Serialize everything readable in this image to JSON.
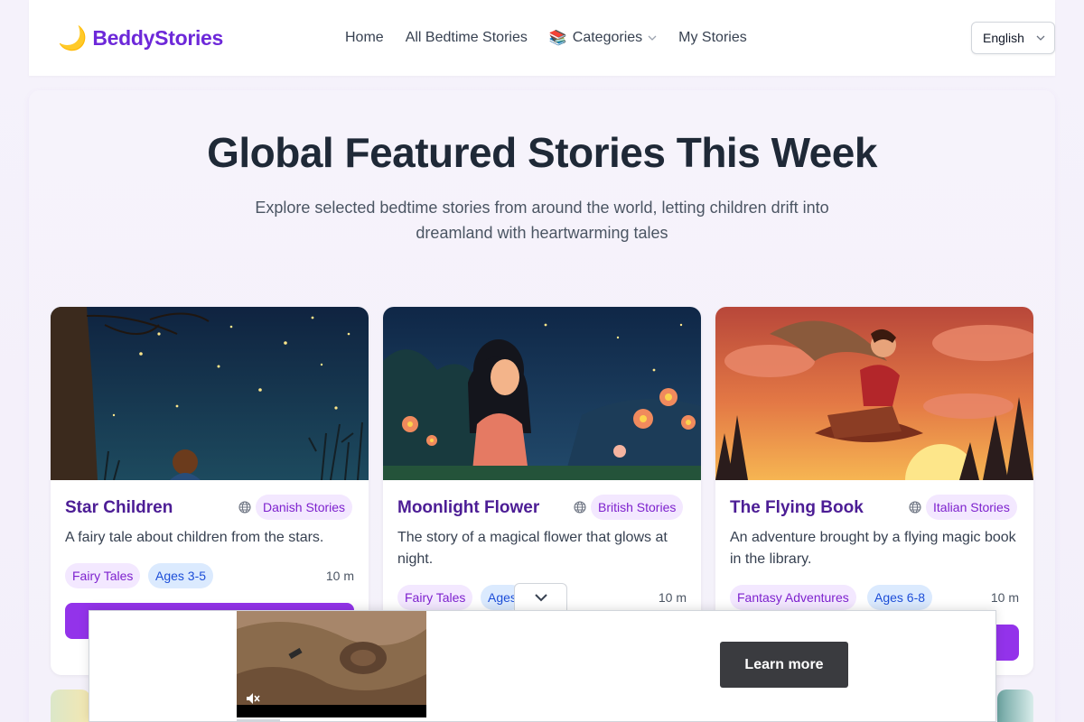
{
  "brand": {
    "logo_icon": "🌙",
    "name": "BeddyStories",
    "color": "#6d28d9"
  },
  "nav": {
    "home": "Home",
    "all_stories": "All Bedtime Stories",
    "categories_icon": "📚",
    "categories": "Categories",
    "my_stories": "My Stories"
  },
  "language": {
    "selected": "English"
  },
  "hero": {
    "title": "Global Featured Stories This Week",
    "subtitle": "Explore selected bedtime stories from around the world, letting children drift into dreamland with heartwarming tales"
  },
  "stories": [
    {
      "title": "Star Children",
      "origin": "Danish Stories",
      "description": "A fairy tale about children from the stars.",
      "tags": [
        "Fairy Tales",
        "Ages 3-5"
      ],
      "read_time": "10 m",
      "image": "starry-night-boy-under-tree"
    },
    {
      "title": "Moonlight Flower",
      "origin": "British Stories",
      "description": "The story of a magical flower that glows at night.",
      "tags": [
        "Fairy Tales",
        "Ages"
      ],
      "read_time": "10 m",
      "image": "girl-with-glowing-flowers"
    },
    {
      "title": "The Flying Book",
      "origin": "Italian Stories",
      "description": "An adventure brought by a flying magic book in the library.",
      "tags": [
        "Fantasy Adventures",
        "Ages 6-8"
      ],
      "read_time": "10 m",
      "image": "boy-riding-winged-book-sunset"
    }
  ],
  "ad": {
    "cta": "Learn more",
    "video": "desert-aerial-video"
  },
  "colors": {
    "accent": "#9333ea",
    "badge_bg": "#f3e8ff",
    "badge_text": "#7e22ce",
    "age_bg": "#dbeafe",
    "age_text": "#1d4ed8"
  }
}
